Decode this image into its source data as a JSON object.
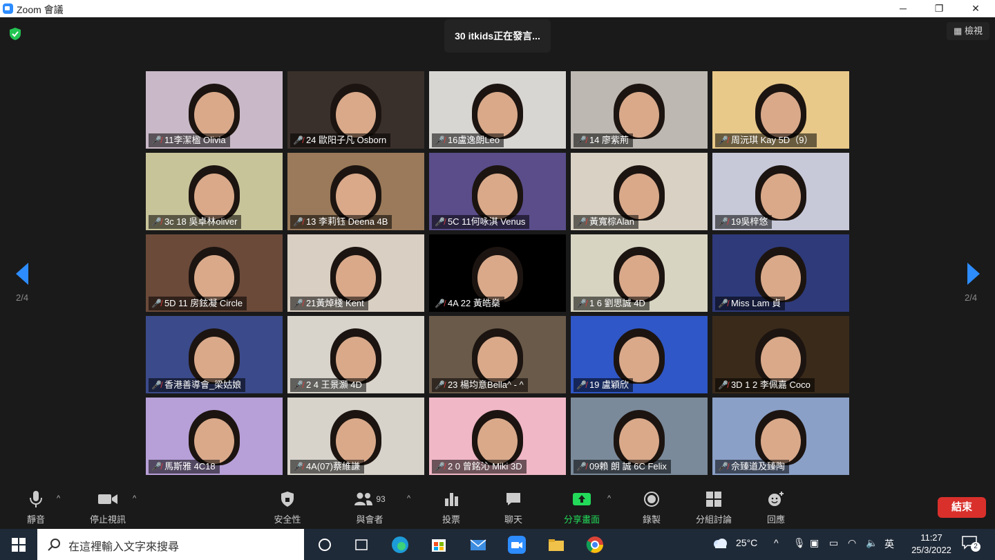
{
  "window": {
    "title": "Zoom 會議",
    "minimize": "─",
    "maximize": "❐",
    "close": "✕"
  },
  "header": {
    "speaking": "30 itkids正在發言...",
    "view_label": "檢視"
  },
  "pager": {
    "left_label": "2/4",
    "right_label": "2/4"
  },
  "participants": [
    {
      "name": "11李潔楹 Olivia",
      "bg": "#c9b9c8"
    },
    {
      "name": "24 歐阳子凡 Osborn",
      "bg": "#3a302b"
    },
    {
      "name": "16盧逸朗Leo",
      "bg": "#d8d6d3"
    },
    {
      "name": "14 廖紫荊",
      "bg": "#bdb8b1"
    },
    {
      "name": "周沅琪 Kay 5D（9）",
      "bg": "#e9c98a"
    },
    {
      "name": "3c 18 吳卓林oliver",
      "bg": "#c8c49a"
    },
    {
      "name": "13 李莉钰 Deena 4B",
      "bg": "#9a7a5a"
    },
    {
      "name": "5C 11何咏淇 Venus",
      "bg": "#5a4d8a"
    },
    {
      "name": "黃寬棕Alan",
      "bg": "#d9d2c4"
    },
    {
      "name": "19吳梓悠",
      "bg": "#c7c9d9"
    },
    {
      "name": "5D 11 房鉉凝 Circle",
      "bg": "#6b4a3a"
    },
    {
      "name": "21黃焯棧 Kent",
      "bg": "#d9cfc2"
    },
    {
      "name": "4A 22 黃皓燊",
      "bg": "#000000"
    },
    {
      "name": "1 6 劉思誠 4D",
      "bg": "#d7d5c2"
    },
    {
      "name": "Miss Lam 貞",
      "bg": "#2e3a7a"
    },
    {
      "name": "香港善導會_梁姑娘",
      "bg": "#3b4a8a"
    },
    {
      "name": "2 4 王景灝 4D",
      "bg": "#d8d4cc"
    },
    {
      "name": "23 楊均意Bella^ - ^",
      "bg": "#6a5a4a"
    },
    {
      "name": "19 盧穎欣",
      "bg": "#2f57c7"
    },
    {
      "name": "3D 1 2 李佩嘉 Coco",
      "bg": "#3a2a1a"
    },
    {
      "name": "馬斯雅 4C18",
      "bg": "#b7a0d8"
    },
    {
      "name": "4A(07)蔡維謙",
      "bg": "#d7d3cb"
    },
    {
      "name": "2 0 曾銘沁 Miki 3D",
      "bg": "#f0b7c6"
    },
    {
      "name": "09賴 朗 誠 6C Felix",
      "bg": "#7a8a9a"
    },
    {
      "name": "佘臻道及臻陶",
      "bg": "#8aa0c7"
    }
  ],
  "toolbar": {
    "mute": "靜音",
    "stop_video": "停止視訊",
    "security": "安全性",
    "participants": "與會者",
    "participants_count": "93",
    "polling": "投票",
    "chat": "聊天",
    "share": "分享畫面",
    "record": "錄製",
    "breakout": "分組討論",
    "reactions": "回應",
    "end": "結束"
  },
  "taskbar": {
    "search_placeholder": "在這裡輸入文字來搜尋",
    "weather": "25°C",
    "ime": "英",
    "time": "11:27",
    "date": "25/3/2022",
    "notifications": "2"
  },
  "colors": {
    "share_green": "#23d959",
    "end_red": "#d9302c",
    "accent_blue": "#2d8cff",
    "muted_red": "#e53e3e"
  }
}
